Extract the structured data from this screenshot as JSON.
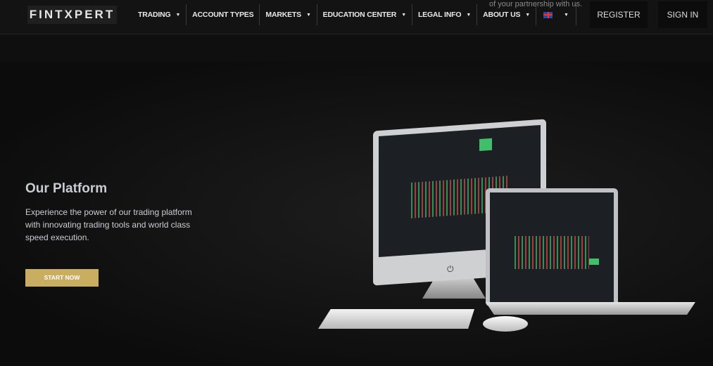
{
  "header": {
    "logo": "FINTXPERT",
    "nav": [
      {
        "label": "TRADING",
        "dropdown": true
      },
      {
        "label": "ACCOUNT TYPES",
        "dropdown": false
      },
      {
        "label": "MARKETS",
        "dropdown": true
      },
      {
        "label": "EDUCATION CENTER",
        "dropdown": true
      },
      {
        "label": "LEGAL INFO",
        "dropdown": true
      },
      {
        "label": "ABOUT US",
        "dropdown": true
      }
    ],
    "language_icon": "uk-flag-icon",
    "overflow_text": "of your partnership with us.",
    "register": "REGISTER",
    "sign_in": "SIGN IN"
  },
  "hero": {
    "title": "Our Platform",
    "description": "Experience the power of our trading platform with innovating trading tools and world class speed execution.",
    "cta": "START NOW",
    "accent": "#c9ad61"
  }
}
